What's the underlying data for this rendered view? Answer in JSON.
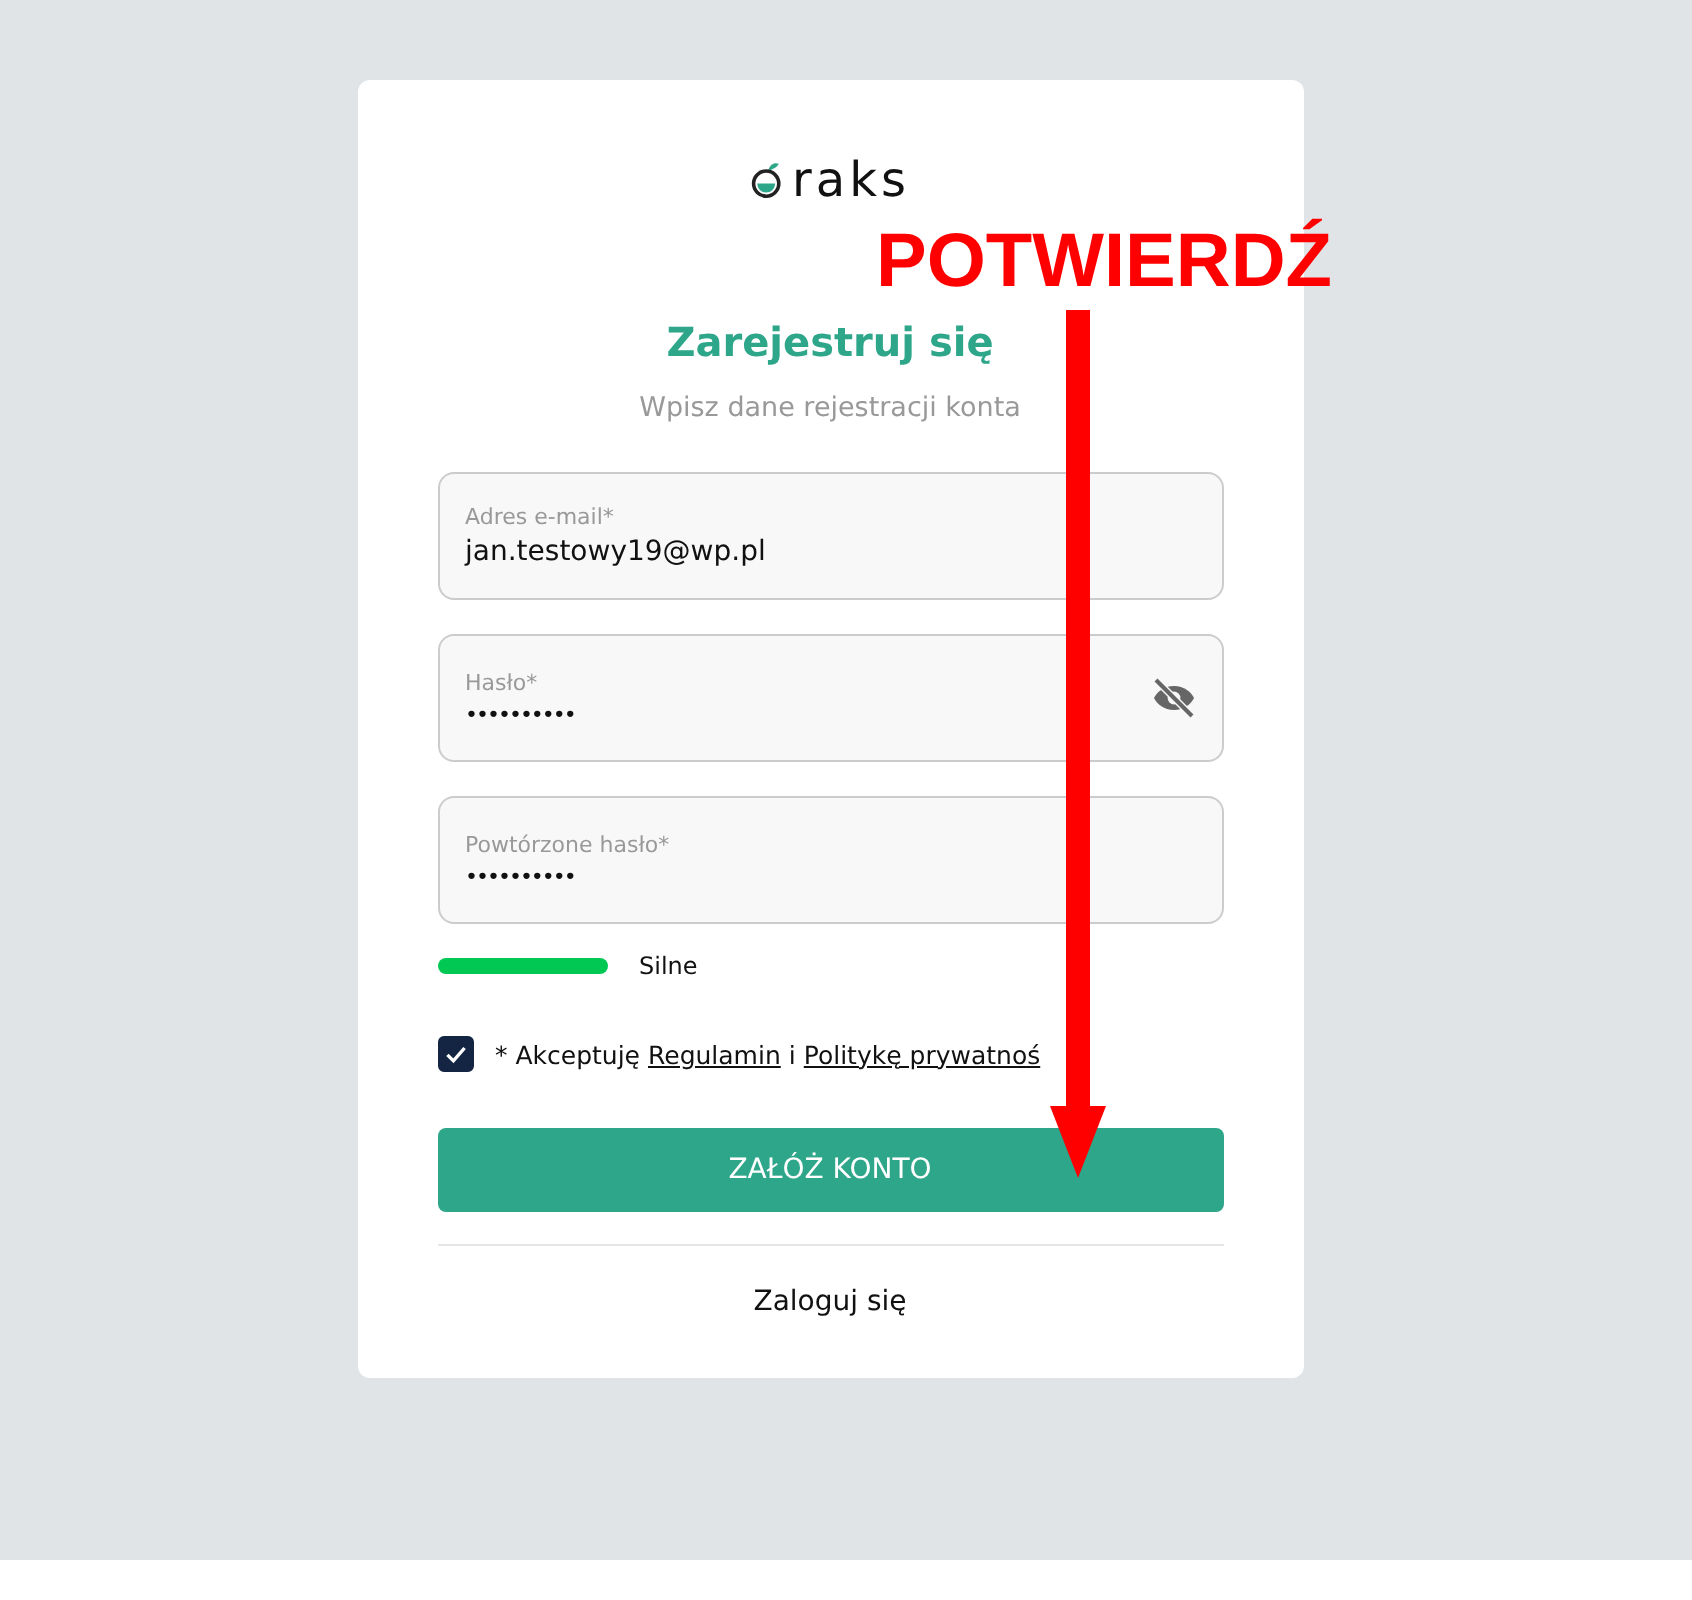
{
  "logo": {
    "text": "raks"
  },
  "title": "Zarejestruj się",
  "subtitle": "Wpisz dane rejestracji konta",
  "fields": [
    {
      "label": "Adres e-mail*",
      "value": "jan.testowy19@wp.pl",
      "kind": "text"
    },
    {
      "label": "Hasło*",
      "value": "••••••••••",
      "kind": "password"
    },
    {
      "label": "Powtórzone hasło*",
      "value": "••••••••••",
      "kind": "plain"
    }
  ],
  "strength": {
    "label": "Silne"
  },
  "consent": {
    "checked": true,
    "text": "* Akceptuję",
    "link_1": "Regulamin",
    "joiner": "i",
    "link_2": "Politykę prywatnoś"
  },
  "submit": "ZAŁÓŻ KONTO",
  "login_link": "Zaloguj się",
  "annotation": {
    "text": "POTWIERDŹ"
  }
}
